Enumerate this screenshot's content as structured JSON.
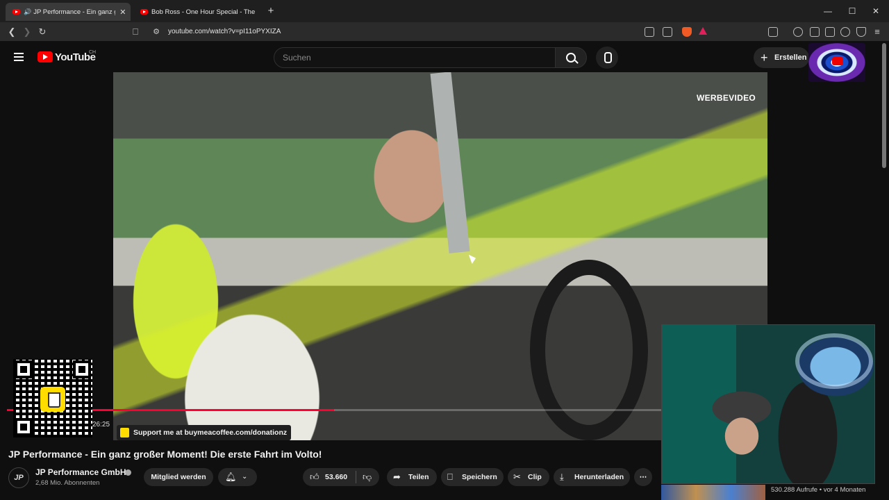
{
  "browser": {
    "tabs": [
      {
        "title": "JP Performance - Ein ganz gro",
        "active": true
      },
      {
        "title": "Bob Ross - One Hour Special - The G",
        "active": false
      }
    ],
    "url": "youtube.com/watch?v=pI11oPYXIZA",
    "new_tab": "+",
    "window_controls": [
      "—",
      "☐",
      "✕"
    ]
  },
  "youtube": {
    "logo_text": "YouTube",
    "country": "CH",
    "search_placeholder": "Suchen",
    "create_label": "Erstellen"
  },
  "video": {
    "overlay_label": "WERBEVIDEO",
    "timecode": "26:25",
    "progress": 0.5,
    "coffee_banner": "Support me at buymeacoffee.com/donationz",
    "title": "JP Performance - Ein ganz großer Moment! Die erste Fahrt im Volto!"
  },
  "channel": {
    "logo": "JP",
    "name": "JP Performance GmbH",
    "subscribers": "2,68 Mio. Abonnenten",
    "member_label": "Mitglied werden"
  },
  "actions": {
    "likes": "53.660",
    "share": "Teilen",
    "save": "Speichern",
    "clip": "Clip",
    "download": "Herunterladen",
    "more": "⋯"
  },
  "meta": {
    "views": "530.288 Aufrufe • vor 4 Monaten"
  },
  "colors": {
    "youtube_red": "#ff0000",
    "progress_red": "#ff0033",
    "coffee_yellow": "#ffdd00"
  }
}
